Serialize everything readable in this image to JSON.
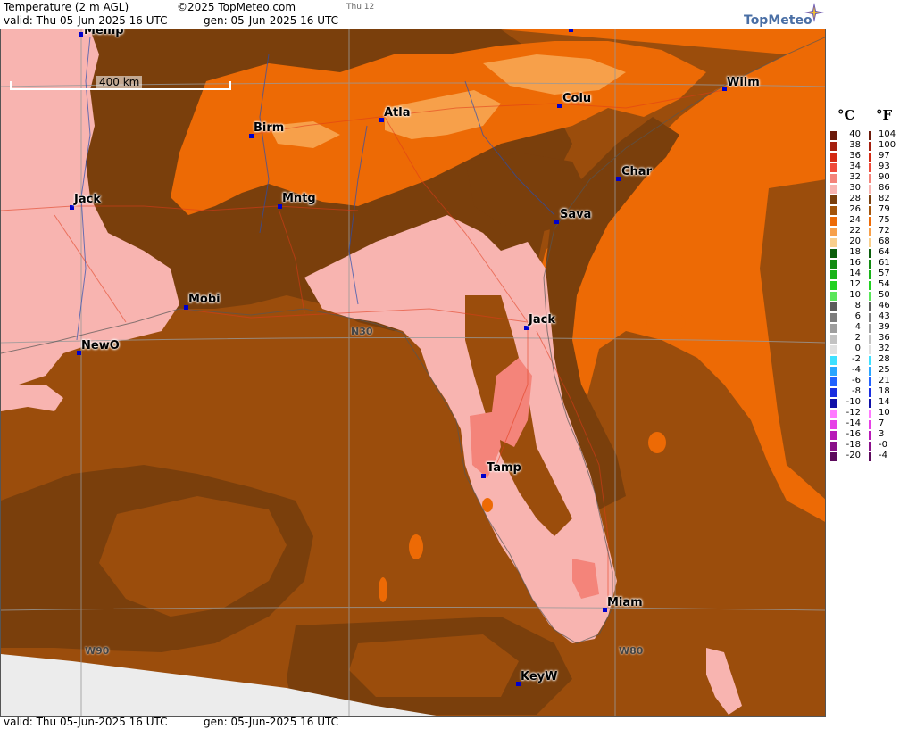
{
  "header": {
    "title": "Temperature (2 m AGL)",
    "copyright": "©2025 TopMeteo.com",
    "day_tag": "Thu 12",
    "valid": "valid:  Thu  05-Jun-2025  16 UTC",
    "generated": "gen:  05-Jun-2025  16 UTC",
    "logo": "TopMeteo"
  },
  "footer": {
    "valid": "valid:  Thu  05-Jun-2025  16 UTC",
    "generated": "gen:  05-Jun-2025  16 UTC"
  },
  "map": {
    "scale_label": "400 km",
    "grid_labels": {
      "lat": "N30",
      "lon_west": "W90",
      "lon_east": "W80"
    },
    "cities": [
      {
        "name": "Memp",
        "id": "city-memp"
      },
      {
        "name": "Wilm",
        "id": "city-wilm"
      },
      {
        "name": "Atla",
        "id": "city-atla"
      },
      {
        "name": "Colu",
        "id": "city-colu"
      },
      {
        "name": "Birm",
        "id": "city-birm"
      },
      {
        "name": "Char",
        "id": "city-char"
      },
      {
        "name": "Jack",
        "id": "city-jack-ms"
      },
      {
        "name": "Mntg",
        "id": "city-mntg"
      },
      {
        "name": "Sava",
        "id": "city-sava"
      },
      {
        "name": "Mobi",
        "id": "city-mobi"
      },
      {
        "name": "Jack",
        "id": "city-jack-fl"
      },
      {
        "name": "NewO",
        "id": "city-newo"
      },
      {
        "name": "Tamp",
        "id": "city-tamp"
      },
      {
        "name": "Miam",
        "id": "city-miam"
      },
      {
        "name": "KeyW",
        "id": "city-keyw"
      }
    ]
  },
  "legend": {
    "celsius_header": "°C",
    "fahrenheit_header": "°F",
    "entries": [
      {
        "c": "40",
        "f": "104",
        "color": "#6b1a0a"
      },
      {
        "c": "38",
        "f": "100",
        "color": "#a5200f"
      },
      {
        "c": "36",
        "f": "97",
        "color": "#d42a14"
      },
      {
        "c": "34",
        "f": "93",
        "color": "#ef4a3a"
      },
      {
        "c": "32",
        "f": "90",
        "color": "#f4847a"
      },
      {
        "c": "30",
        "f": "86",
        "color": "#f8b4b0"
      },
      {
        "c": "28",
        "f": "82",
        "color": "#7a3f0c"
      },
      {
        "c": "26",
        "f": "79",
        "color": "#a3540a"
      },
      {
        "c": "24",
        "f": "75",
        "color": "#ed6a05"
      },
      {
        "c": "22",
        "f": "72",
        "color": "#f7a04a"
      },
      {
        "c": "20",
        "f": "68",
        "color": "#f9cf8c"
      },
      {
        "c": "18",
        "f": "64",
        "color": "#0b5e0b"
      },
      {
        "c": "16",
        "f": "61",
        "color": "#128a12"
      },
      {
        "c": "14",
        "f": "57",
        "color": "#19b319"
      },
      {
        "c": "12",
        "f": "54",
        "color": "#22d122"
      },
      {
        "c": "10",
        "f": "50",
        "color": "#5ae65a"
      },
      {
        "c": "8",
        "f": "46",
        "color": "#5c5c5c"
      },
      {
        "c": "6",
        "f": "43",
        "color": "#7d7d7d"
      },
      {
        "c": "4",
        "f": "39",
        "color": "#9e9e9e"
      },
      {
        "c": "2",
        "f": "36",
        "color": "#c2c2c2"
      },
      {
        "c": "0",
        "f": "32",
        "color": "#e0e0e0"
      },
      {
        "c": "-2",
        "f": "28",
        "color": "#3fe0ff"
      },
      {
        "c": "-4",
        "f": "25",
        "color": "#2aa6ff"
      },
      {
        "c": "-6",
        "f": "21",
        "color": "#2262ff"
      },
      {
        "c": "-8",
        "f": "18",
        "color": "#1a2ee0"
      },
      {
        "c": "-10",
        "f": "14",
        "color": "#1010a8"
      },
      {
        "c": "-12",
        "f": "10",
        "color": "#ff7aff"
      },
      {
        "c": "-14",
        "f": "7",
        "color": "#e640e6"
      },
      {
        "c": "-16",
        "f": "3",
        "color": "#b81ab8"
      },
      {
        "c": "-18",
        "f": "-0",
        "color": "#8a108a"
      },
      {
        "c": "-20",
        "f": "-4",
        "color": "#5c0a5c"
      }
    ]
  },
  "colors": {
    "gulf_brown": "#9b4d0c",
    "dark_brown": "#7a3f0c",
    "orange": "#ed6a05",
    "light_orange": "#f7a04a",
    "pink": "#f8b4b0",
    "salmon": "#f4847a",
    "no_data": "#ececec",
    "city_dot": "#0000cc"
  }
}
